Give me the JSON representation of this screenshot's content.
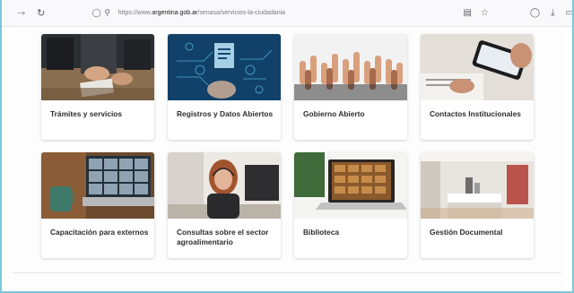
{
  "browser": {
    "url_prefix": "https://www.",
    "url_domain": "argentina.gob.ar",
    "url_path": "/senasa/servicios-la-ciudadania",
    "icons": {
      "back": "arrow-left-icon",
      "reload": "reload-icon",
      "shield": "shield-icon",
      "lock": "lock-icon",
      "reader": "reader-view-icon",
      "bookmark": "star-icon",
      "pocket": "pocket-icon",
      "download": "download-icon",
      "extensions": "extensions-icon"
    }
  },
  "cards": [
    {
      "title": "Trámites y servicios",
      "image": "meeting-hands-photo"
    },
    {
      "title": "Registros y Datos Abiertos",
      "image": "digital-documents-photo"
    },
    {
      "title": "Gobierno Abierto",
      "image": "raised-hands-photo"
    },
    {
      "title": "Contactos Institucionales",
      "image": "smartphone-photo"
    },
    {
      "title": "Capacitación para externos",
      "image": "video-call-laptop-photo"
    },
    {
      "title": "Consultas sobre el sector agroalimentario",
      "image": "call-center-agent-photo"
    },
    {
      "title": "Biblioteca",
      "image": "laptop-library-photo"
    },
    {
      "title": "Gestión Documental",
      "image": "office-photo"
    }
  ]
}
